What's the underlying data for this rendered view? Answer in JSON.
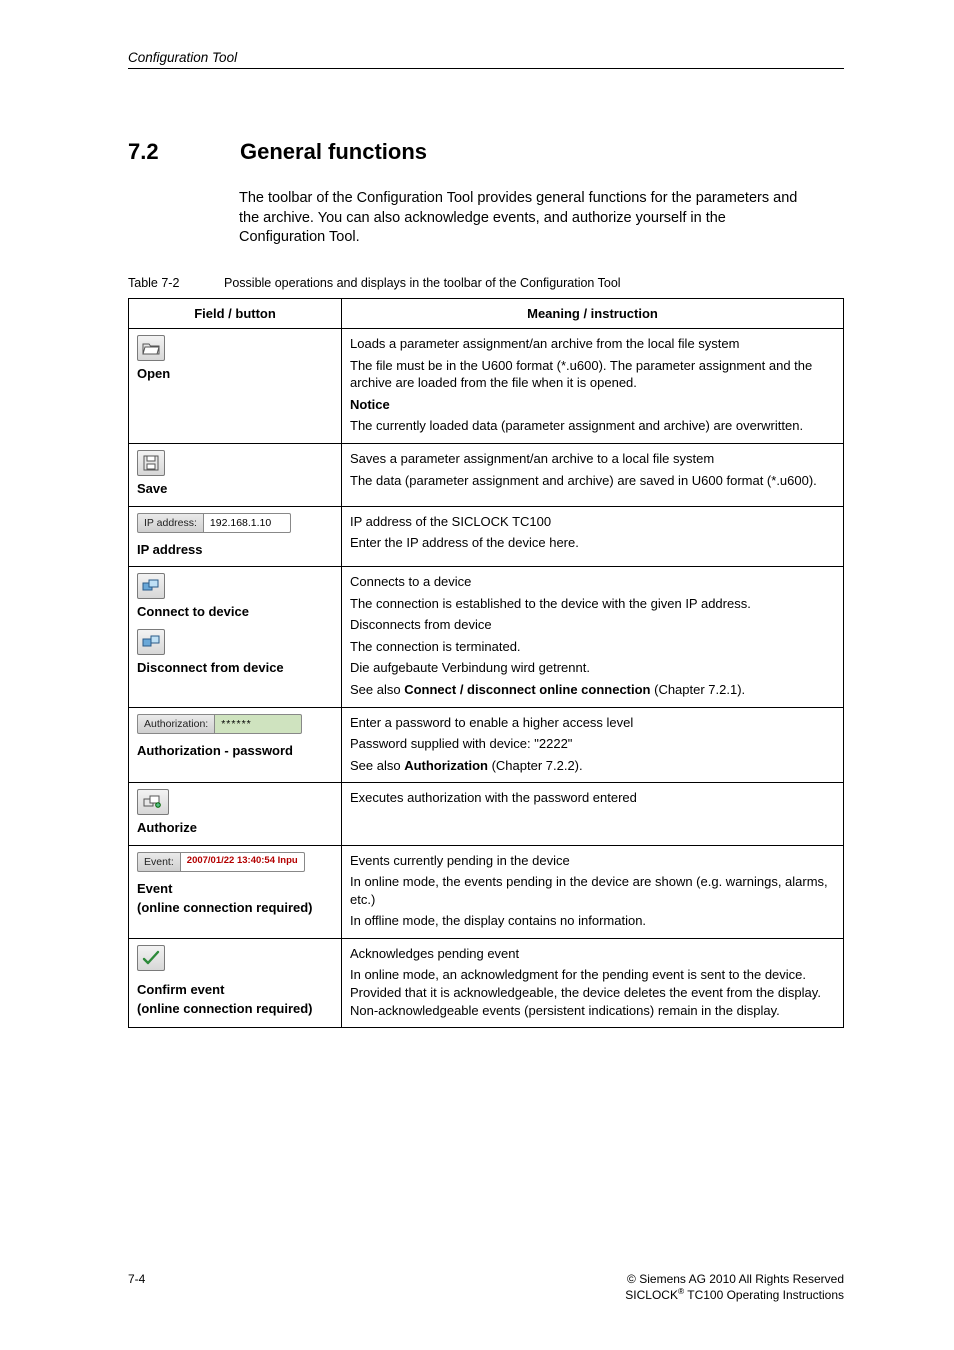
{
  "header": {
    "running": "Configuration Tool"
  },
  "section": {
    "number": "7.2",
    "title": "General functions"
  },
  "intro": "The toolbar of the Configuration Tool provides general functions for the parameters and the archive. You can also acknowledge events, and authorize yourself in the Configuration Tool.",
  "table": {
    "caption_label": "Table 7-2",
    "caption_text": "Possible operations and displays in the toolbar of the Configuration Tool",
    "head_field": "Field / button",
    "head_meaning": "Meaning / instruction",
    "rows": {
      "open": {
        "label": "Open",
        "p1": "Loads a parameter assignment/an archive from the local file system",
        "p2": "The file must be in the U600 format (*.u600). The parameter assignment and the archive are loaded from the file when it is opened.",
        "notice_label": "Notice",
        "notice_text": "The currently loaded data (parameter assignment and archive) are overwritten."
      },
      "save": {
        "label": "Save",
        "p1": "Saves a parameter assignment/an archive to a local file system",
        "p2": "The data (parameter assignment and archive) are saved in U600 format (*.u600)."
      },
      "ip": {
        "field_label": "IP address:",
        "field_value": "192.168.1.10",
        "label": "IP address",
        "p1": "IP address of the SICLOCK TC100",
        "p2": "Enter the IP address of the device here."
      },
      "connect": {
        "label1": "Connect to device",
        "label2": "Disconnect from device",
        "p1": "Connects to a device",
        "p2": "The connection is established to the device with the given IP address.",
        "p3": "Disconnects from device",
        "p4": "The connection is terminated.",
        "p5": "Die aufgebaute Verbindung wird getrennt.",
        "p6a": "See also ",
        "p6b": "Connect / disconnect online connection",
        "p6c": " (Chapter 7.2.1)."
      },
      "auth": {
        "field_label": "Authorization:",
        "field_value": "******",
        "label": "Authorization - password",
        "p1": "Enter a password to enable a higher access level",
        "p2": "Password supplied with device: \"2222\"",
        "p3a": "See also ",
        "p3b": "Authorization",
        "p3c": " (Chapter 7.2.2)."
      },
      "authorize": {
        "label": "Authorize",
        "p1": "Executes authorization with the password entered"
      },
      "event": {
        "field_label": "Event:",
        "field_value": "2007/01/22 13:40:54 Inpu",
        "label1": "Event",
        "label2": "(online connection required)",
        "p1": "Events currently pending in the device",
        "p2": "In online mode, the events pending in the device are shown (e.g. warnings, alarms, etc.)",
        "p3": "In offline mode, the display contains no information."
      },
      "confirm": {
        "label1": "Confirm event",
        "label2": "(online connection required)",
        "p1": "Acknowledges pending event",
        "p2": "In online mode, an acknowledgment for the pending event is sent to the device. Provided that it is acknowledgeable, the device deletes the event from the display. Non-acknowledgeable events (persistent indications) remain in the display."
      }
    }
  },
  "footer": {
    "page": "7-4",
    "copyright": "©  Siemens AG 2010 All Rights Reserved",
    "product": "SICLOCK® TC100 Operating Instructions"
  }
}
